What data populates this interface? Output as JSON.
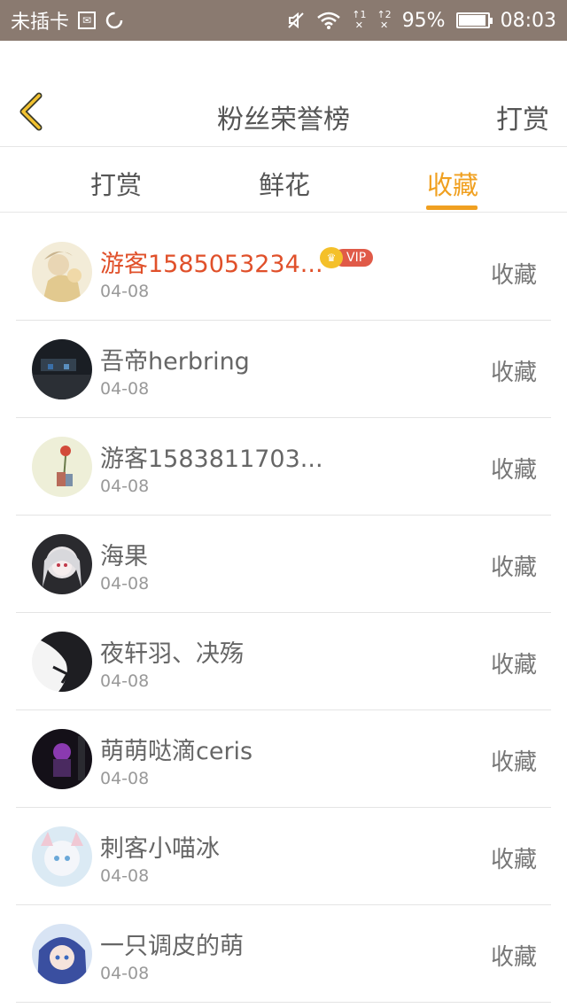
{
  "status_bar": {
    "carrier": "未插卡",
    "signal1": "↑1",
    "signal2": "↑2",
    "battery_percent": "95%",
    "battery_level": 0.95,
    "time": "08:03"
  },
  "header": {
    "title": "粉丝荣誉榜",
    "action_label": "打赏"
  },
  "tabs": [
    {
      "label": "打赏",
      "active": false
    },
    {
      "label": "鲜花",
      "active": false
    },
    {
      "label": "收藏",
      "active": true
    }
  ],
  "colors": {
    "accent": "#f0a020",
    "vip_name": "#e0502a",
    "statusbar": "#8a7a70"
  },
  "list": [
    {
      "name": "游客1585053234...",
      "date": "04-08",
      "action": "收藏",
      "vip": true,
      "vip_label": "VIP",
      "avatar": "anime-girl-light"
    },
    {
      "name": "吾帝herbring",
      "date": "04-08",
      "action": "收藏",
      "vip": false,
      "avatar": "dark-scene"
    },
    {
      "name": "游客1583811703...",
      "date": "04-08",
      "action": "收藏",
      "vip": false,
      "avatar": "rose-sketch"
    },
    {
      "name": "海果",
      "date": "04-08",
      "action": "收藏",
      "vip": false,
      "avatar": "anime-silver-hair"
    },
    {
      "name": "夜轩羽、决殇",
      "date": "04-08",
      "action": "收藏",
      "vip": false,
      "avatar": "dark-silhouette"
    },
    {
      "name": "萌萌哒滴ceris",
      "date": "04-08",
      "action": "收藏",
      "vip": false,
      "avatar": "purple-night"
    },
    {
      "name": "刺客小喵冰",
      "date": "04-08",
      "action": "收藏",
      "vip": false,
      "avatar": "anime-white-cat"
    },
    {
      "name": "一只调皮的萌",
      "date": "04-08",
      "action": "收藏",
      "vip": false,
      "avatar": "anime-blue-hair"
    }
  ]
}
